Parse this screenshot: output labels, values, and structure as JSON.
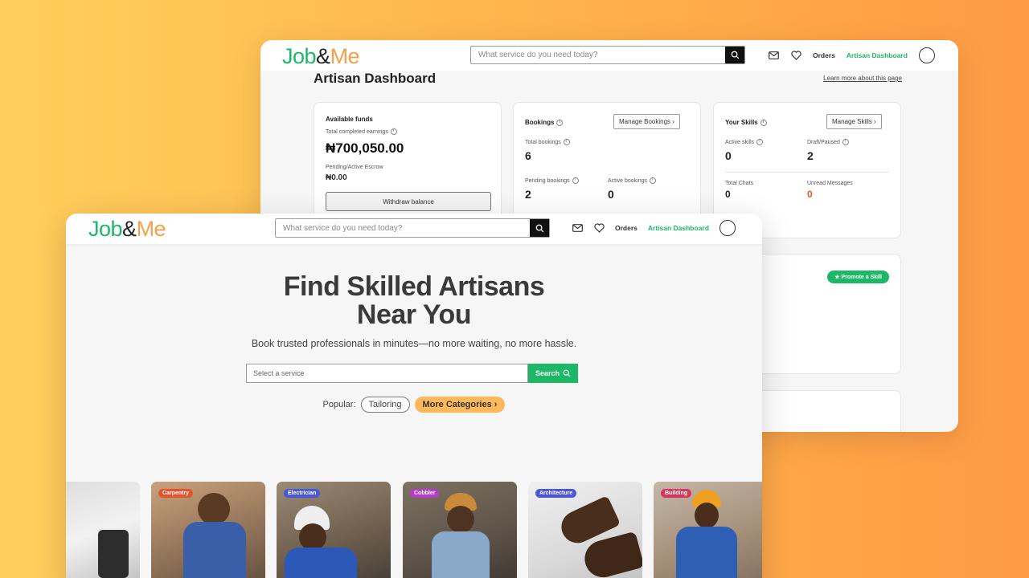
{
  "brand": {
    "part1": "Job",
    "part2": "&",
    "part3": "Me"
  },
  "nav": {
    "search_placeholder": "What service do you need today?",
    "orders": "Orders",
    "dashboard": "Artisan Dashboard",
    "icons": [
      "mail-icon",
      "heart-icon",
      "search-icon"
    ]
  },
  "dashboard": {
    "title": "Artisan Dashboard",
    "learn_more": "Learn more about this page",
    "funds": {
      "title": "Available funds",
      "earnings_label": "Total completed earnings",
      "earnings_value": "₦700,050.00",
      "escrow_label": "Pending/Active Escrow",
      "escrow_value": "₦0.00",
      "withdraw": "Withdraw balance"
    },
    "bookings": {
      "title": "Bookings",
      "manage": "Manage Bookings",
      "total_label": "Total bookings",
      "total_value": "6",
      "pending_label": "Pending bookings",
      "pending_value": "2",
      "active_label": "Active bookings",
      "active_value": "0"
    },
    "skills": {
      "title": "Your Skills",
      "manage": "Manage Skills",
      "active_label": "Active skills",
      "active_value": "0",
      "draft_label": "Draft/Paused",
      "draft_value": "2",
      "chats_label": "Total Chats",
      "chats_value": "0",
      "unread_label": "Unread Messages",
      "unread_value": "0"
    },
    "promote": "★ Promote a Skill"
  },
  "landing": {
    "hero_line1": "Find Skilled Artisans",
    "hero_line2": "Near You",
    "subtitle": "Book trusted professionals in minutes—no more waiting, no more hassle.",
    "search_placeholder": "Select a service",
    "search_button": "Search",
    "popular_label": "Popular:",
    "popular_chip": "Tailoring",
    "more_categories": "More Categories",
    "tiles": [
      {
        "tag": "",
        "tag_color": "#888888"
      },
      {
        "tag": "Carpentry",
        "tag_color": "#e5532d"
      },
      {
        "tag": "Electrician",
        "tag_color": "#4a57d6"
      },
      {
        "tag": "Cobbler",
        "tag_color": "#b93cc9"
      },
      {
        "tag": "Architecture",
        "tag_color": "#4a57d6"
      },
      {
        "tag": "Building",
        "tag_color": "#d6365a"
      }
    ]
  },
  "colors": {
    "brand_green": "#1db866",
    "brand_orange": "#f5a04a",
    "unread_red": "#e5532d"
  }
}
